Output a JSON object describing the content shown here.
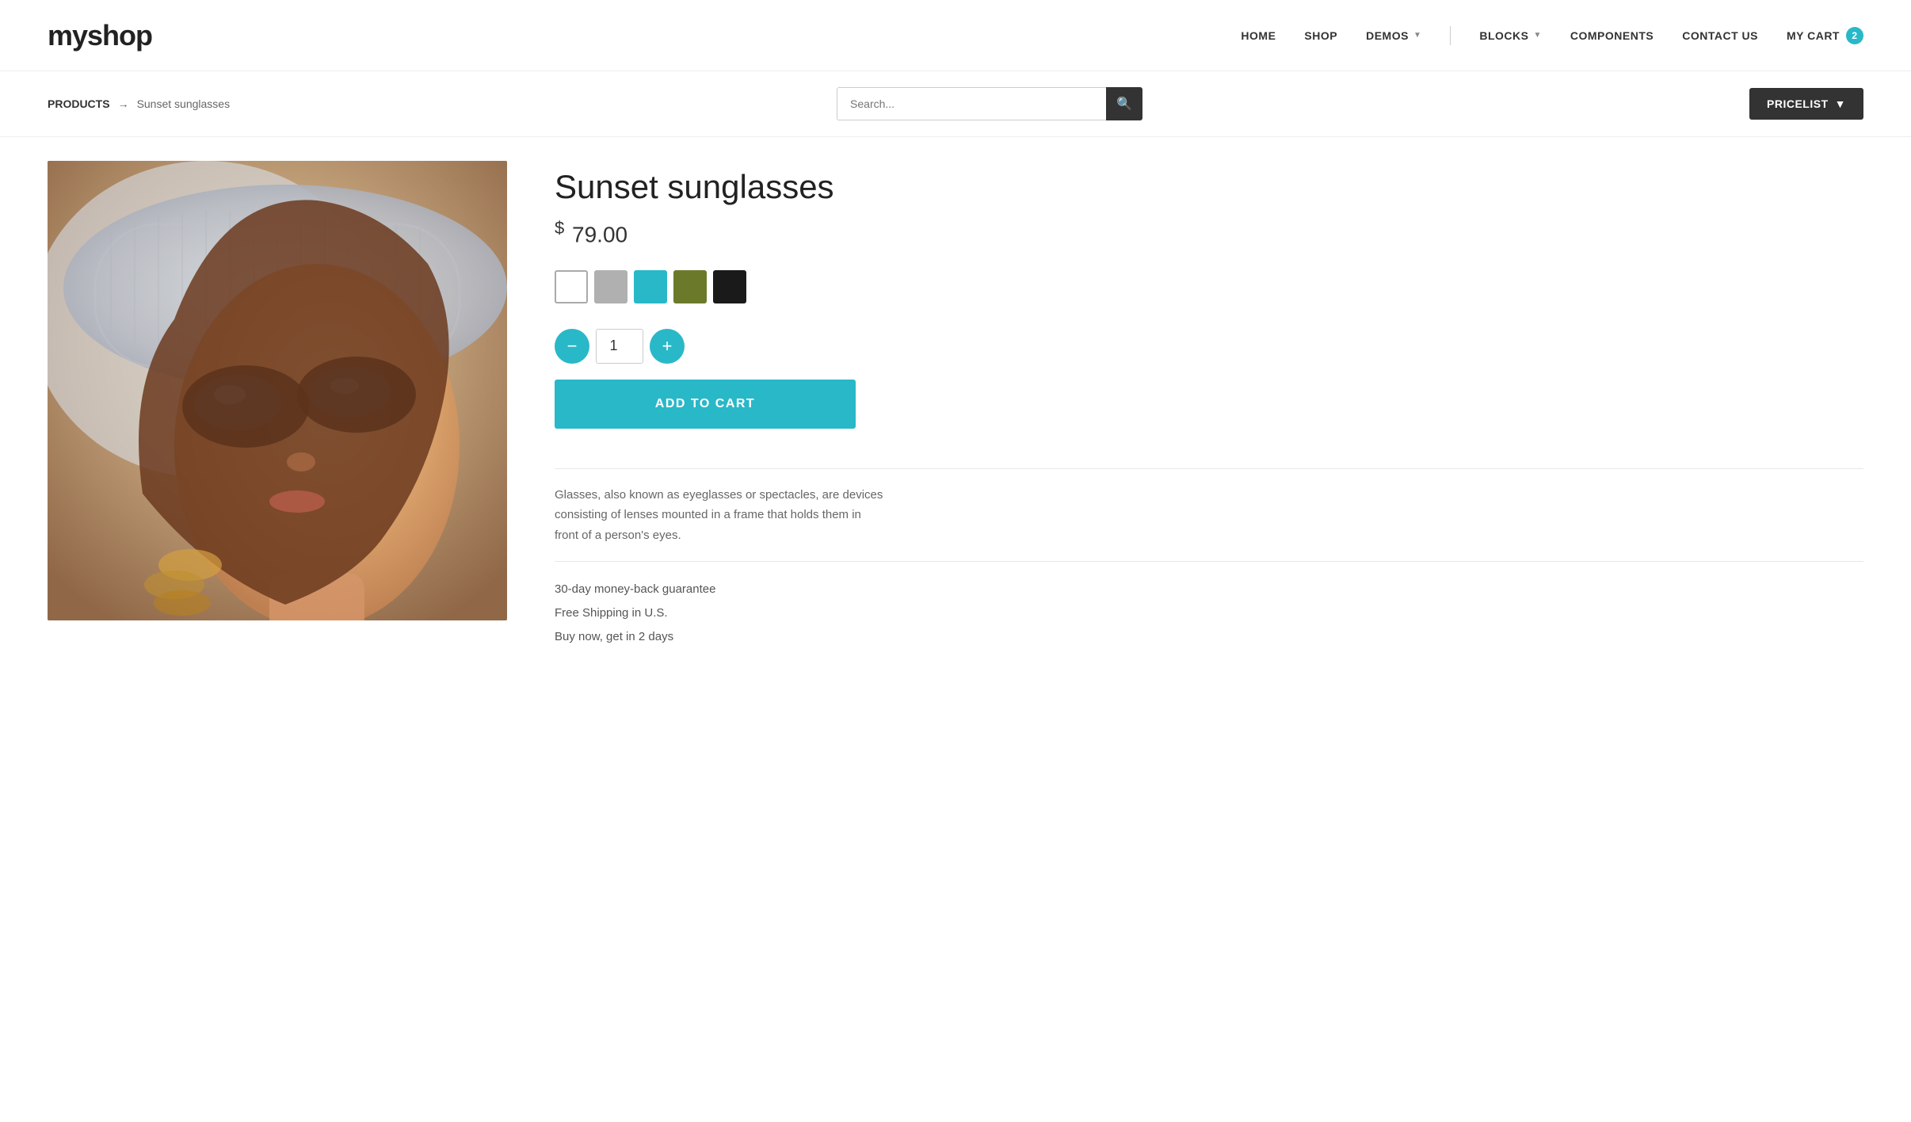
{
  "logo": {
    "text_my": "my",
    "text_shop": "shop"
  },
  "nav": {
    "items": [
      {
        "id": "home",
        "label": "HOME",
        "hasDropdown": false
      },
      {
        "id": "shop",
        "label": "SHOP",
        "hasDropdown": false
      },
      {
        "id": "demos",
        "label": "DEMOS",
        "hasDropdown": true
      },
      {
        "id": "blocks",
        "label": "BLOCKS",
        "hasDropdown": true
      },
      {
        "id": "components",
        "label": "COMPONENTS",
        "hasDropdown": false
      },
      {
        "id": "contact",
        "label": "CONTACT US",
        "hasDropdown": false
      }
    ],
    "cart_label": "MY CART",
    "cart_count": "2"
  },
  "toolbar": {
    "breadcrumb_products": "PRODUCTS",
    "breadcrumb_current": "Sunset sunglasses",
    "search_placeholder": "Search...",
    "pricelist_label": "PRICELIST"
  },
  "product": {
    "title": "Sunset sunglasses",
    "price_symbol": "$",
    "price": "79.00",
    "colors": [
      {
        "id": "white",
        "label": "White"
      },
      {
        "id": "gray",
        "label": "Gray"
      },
      {
        "id": "teal",
        "label": "Teal",
        "active": true
      },
      {
        "id": "olive",
        "label": "Olive"
      },
      {
        "id": "black",
        "label": "Black"
      }
    ],
    "quantity": "1",
    "add_to_cart_label": "ADD TO CART",
    "description": "Glasses, also known as eyeglasses or spectacles, are devices consisting of lenses mounted in a frame that holds them in front of a person's eyes.",
    "features": [
      "30-day money-back guarantee",
      "Free Shipping in U.S.",
      "Buy now, get in 2 days"
    ]
  }
}
